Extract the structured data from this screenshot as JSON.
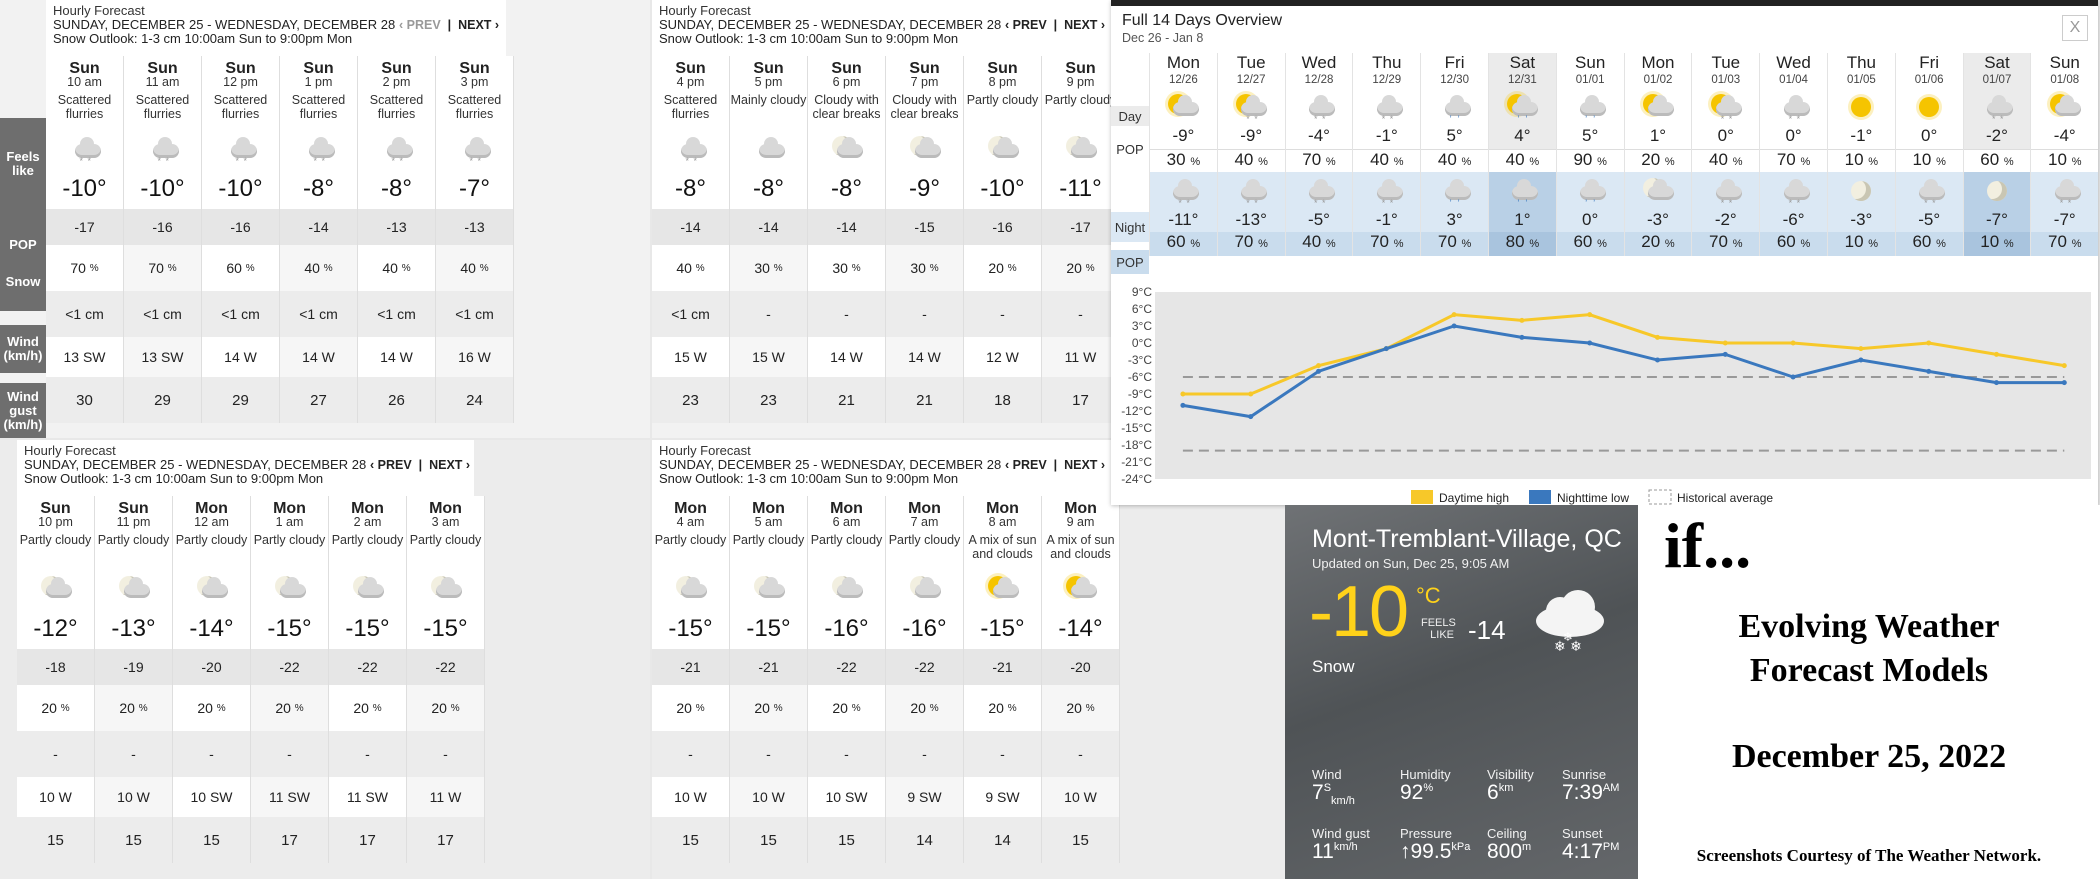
{
  "hourly_common": {
    "title": "Hourly Forecast",
    "dates": "SUNDAY, DECEMBER 25 - WEDNESDAY, DECEMBER 28",
    "outlook": "Snow Outlook: 1-3 cm 10:00am Sun to 9:00pm Mon",
    "prev": "‹ PREV",
    "next": "NEXT ›"
  },
  "row_labels": {
    "feels_like": "Feels like",
    "pop": "POP",
    "snow": "Snow",
    "wind": "Wind (km/h)",
    "wind_gust": "Wind gust (km/h)"
  },
  "panels": [
    {
      "hours": [
        {
          "day": "Sun",
          "hour": "10 am",
          "cond": "Scattered flurries",
          "temp": "-10°",
          "feels": "-17",
          "pop": "70",
          "snow": "<1 cm",
          "wind": "13 SW",
          "gust": "30",
          "icon": "cloud-snow-icon"
        },
        {
          "day": "Sun",
          "hour": "11 am",
          "cond": "Scattered flurries",
          "temp": "-10°",
          "feels": "-16",
          "pop": "70",
          "snow": "<1 cm",
          "wind": "13 SW",
          "gust": "29",
          "icon": "cloud-snow-icon"
        },
        {
          "day": "Sun",
          "hour": "12 pm",
          "cond": "Scattered flurries",
          "temp": "-10°",
          "feels": "-16",
          "pop": "60",
          "snow": "<1 cm",
          "wind": "14 W",
          "gust": "29",
          "icon": "cloud-snow-icon"
        },
        {
          "day": "Sun",
          "hour": "1 pm",
          "cond": "Scattered flurries",
          "temp": "-8°",
          "feels": "-14",
          "pop": "40",
          "snow": "<1 cm",
          "wind": "14 W",
          "gust": "27",
          "icon": "cloud-snow-icon"
        },
        {
          "day": "Sun",
          "hour": "2 pm",
          "cond": "Scattered flurries",
          "temp": "-8°",
          "feels": "-13",
          "pop": "40",
          "snow": "<1 cm",
          "wind": "14 W",
          "gust": "26",
          "icon": "cloud-snow-icon"
        },
        {
          "day": "Sun",
          "hour": "3 pm",
          "cond": "Scattered flurries",
          "temp": "-7°",
          "feels": "-13",
          "pop": "40",
          "snow": "<1 cm",
          "wind": "16 W",
          "gust": "24",
          "icon": "cloud-snow-icon"
        }
      ]
    },
    {
      "hours": [
        {
          "day": "Sun",
          "hour": "4 pm",
          "cond": "Scattered flurries",
          "temp": "-8°",
          "feels": "-14",
          "pop": "40",
          "snow": "<1 cm",
          "wind": "15 W",
          "gust": "23",
          "icon": "cloud-snow-icon"
        },
        {
          "day": "Sun",
          "hour": "5 pm",
          "cond": "Mainly cloudy",
          "temp": "-8°",
          "feels": "-14",
          "pop": "30",
          "snow": "-",
          "wind": "15 W",
          "gust": "23",
          "icon": "cloud-icon"
        },
        {
          "day": "Sun",
          "hour": "6 pm",
          "cond": "Cloudy with clear breaks",
          "temp": "-8°",
          "feels": "-14",
          "pop": "30",
          "snow": "-",
          "wind": "14 W",
          "gust": "21",
          "icon": "moon-cloud-icon"
        },
        {
          "day": "Sun",
          "hour": "7 pm",
          "cond": "Cloudy with clear breaks",
          "temp": "-9°",
          "feels": "-15",
          "pop": "30",
          "snow": "-",
          "wind": "14 W",
          "gust": "21",
          "icon": "moon-cloud-icon"
        },
        {
          "day": "Sun",
          "hour": "8 pm",
          "cond": "Partly cloudy",
          "temp": "-10°",
          "feels": "-16",
          "pop": "20",
          "snow": "-",
          "wind": "12 W",
          "gust": "18",
          "icon": "moon-cloud-icon"
        },
        {
          "day": "Sun",
          "hour": "9 pm",
          "cond": "Partly cloudy",
          "temp": "-11°",
          "feels": "-17",
          "pop": "20",
          "snow": "-",
          "wind": "11 W",
          "gust": "17",
          "icon": "moon-cloud-icon"
        }
      ]
    },
    {
      "hours": [
        {
          "day": "Sun",
          "hour": "10 pm",
          "cond": "Partly cloudy",
          "temp": "-12°",
          "feels": "-18",
          "pop": "20",
          "snow": "-",
          "wind": "10 W",
          "gust": "15",
          "icon": "moon-cloud-icon"
        },
        {
          "day": "Sun",
          "hour": "11 pm",
          "cond": "Partly cloudy",
          "temp": "-13°",
          "feels": "-19",
          "pop": "20",
          "snow": "-",
          "wind": "10 W",
          "gust": "15",
          "icon": "moon-cloud-icon"
        },
        {
          "day": "Mon",
          "hour": "12 am",
          "cond": "Partly cloudy",
          "temp": "-14°",
          "feels": "-20",
          "pop": "20",
          "snow": "-",
          "wind": "10 SW",
          "gust": "15",
          "icon": "moon-cloud-icon"
        },
        {
          "day": "Mon",
          "hour": "1 am",
          "cond": "Partly cloudy",
          "temp": "-15°",
          "feels": "-22",
          "pop": "20",
          "snow": "-",
          "wind": "11 SW",
          "gust": "17",
          "icon": "moon-cloud-icon"
        },
        {
          "day": "Mon",
          "hour": "2 am",
          "cond": "Partly cloudy",
          "temp": "-15°",
          "feels": "-22",
          "pop": "20",
          "snow": "-",
          "wind": "11 SW",
          "gust": "17",
          "icon": "moon-cloud-icon"
        },
        {
          "day": "Mon",
          "hour": "3 am",
          "cond": "Partly cloudy",
          "temp": "-15°",
          "feels": "-22",
          "pop": "20",
          "snow": "-",
          "wind": "11 W",
          "gust": "17",
          "icon": "moon-cloud-icon"
        }
      ]
    },
    {
      "hours": [
        {
          "day": "Mon",
          "hour": "4 am",
          "cond": "Partly cloudy",
          "temp": "-15°",
          "feels": "-21",
          "pop": "20",
          "snow": "-",
          "wind": "10 W",
          "gust": "15",
          "icon": "moon-cloud-icon"
        },
        {
          "day": "Mon",
          "hour": "5 am",
          "cond": "Partly cloudy",
          "temp": "-15°",
          "feels": "-21",
          "pop": "20",
          "snow": "-",
          "wind": "10 W",
          "gust": "15",
          "icon": "moon-cloud-icon"
        },
        {
          "day": "Mon",
          "hour": "6 am",
          "cond": "Partly cloudy",
          "temp": "-16°",
          "feels": "-22",
          "pop": "20",
          "snow": "-",
          "wind": "10 SW",
          "gust": "15",
          "icon": "moon-cloud-icon"
        },
        {
          "day": "Mon",
          "hour": "7 am",
          "cond": "Partly cloudy",
          "temp": "-16°",
          "feels": "-22",
          "pop": "20",
          "snow": "-",
          "wind": "9 SW",
          "gust": "14",
          "icon": "moon-cloud-icon"
        },
        {
          "day": "Mon",
          "hour": "8 am",
          "cond": "A mix of sun and clouds",
          "temp": "-15°",
          "feels": "-21",
          "pop": "20",
          "snow": "-",
          "wind": "9 SW",
          "gust": "14",
          "icon": "sun-cloud-icon"
        },
        {
          "day": "Mon",
          "hour": "9 am",
          "cond": "A mix of sun and clouds",
          "temp": "-14°",
          "feels": "-20",
          "pop": "20",
          "snow": "-",
          "wind": "10 W",
          "gust": "15",
          "icon": "sun-cloud-icon"
        }
      ]
    }
  ],
  "overview": {
    "title": "Full 14 Days Overview",
    "range": "Dec 26 - Jan 8",
    "close": "X",
    "row_labels": {
      "day": "Day",
      "pop": "POP",
      "night": "Night",
      "npop": "POP"
    },
    "days": [
      {
        "dow": "Mon",
        "date": "12/26",
        "hi": "-9°",
        "pop": "30",
        "lo": "-11°",
        "npop": "60",
        "dicon": "sun-cloud-icon",
        "nicon": "cloud-snow-icon"
      },
      {
        "dow": "Tue",
        "date": "12/27",
        "hi": "-9°",
        "pop": "40",
        "lo": "-13°",
        "npop": "70",
        "dicon": "sun-cloud-snow-icon",
        "nicon": "cloud-snow-icon"
      },
      {
        "dow": "Wed",
        "date": "12/28",
        "hi": "-4°",
        "pop": "70",
        "lo": "-5°",
        "npop": "40",
        "dicon": "cloud-snow-icon",
        "nicon": "cloud-snow-icon"
      },
      {
        "dow": "Thu",
        "date": "12/29",
        "hi": "-1°",
        "pop": "40",
        "lo": "-1°",
        "npop": "70",
        "dicon": "cloud-snow-icon",
        "nicon": "cloud-snow-icon"
      },
      {
        "dow": "Fri",
        "date": "12/30",
        "hi": "5°",
        "pop": "40",
        "lo": "3°",
        "npop": "70",
        "dicon": "cloud-rain-icon",
        "nicon": "cloud-rain-icon"
      },
      {
        "dow": "Sat",
        "date": "12/31",
        "hi": "4°",
        "pop": "40",
        "lo": "1°",
        "npop": "80",
        "dicon": "sun-cloud-rain-icon",
        "nicon": "cloud-rain-icon",
        "hl": true
      },
      {
        "dow": "Sun",
        "date": "01/01",
        "hi": "5°",
        "pop": "90",
        "lo": "0°",
        "npop": "60",
        "dicon": "cloud-rain-icon",
        "nicon": "cloud-rain-icon"
      },
      {
        "dow": "Mon",
        "date": "01/02",
        "hi": "1°",
        "pop": "20",
        "lo": "-3°",
        "npop": "20",
        "dicon": "sun-cloud-icon",
        "nicon": "moon-cloud-icon"
      },
      {
        "dow": "Tue",
        "date": "01/03",
        "hi": "0°",
        "pop": "40",
        "lo": "-2°",
        "npop": "70",
        "dicon": "sun-cloud-snow-icon",
        "nicon": "cloud-snow-icon"
      },
      {
        "dow": "Wed",
        "date": "01/04",
        "hi": "0°",
        "pop": "70",
        "lo": "-6°",
        "npop": "60",
        "dicon": "cloud-snow-icon",
        "nicon": "cloud-snow-icon"
      },
      {
        "dow": "Thu",
        "date": "01/05",
        "hi": "-1°",
        "pop": "10",
        "lo": "-3°",
        "npop": "10",
        "dicon": "sun-icon",
        "nicon": "moon-icon"
      },
      {
        "dow": "Fri",
        "date": "01/06",
        "hi": "0°",
        "pop": "10",
        "lo": "-5°",
        "npop": "60",
        "dicon": "sun-icon",
        "nicon": "cloud-snow-icon"
      },
      {
        "dow": "Sat",
        "date": "01/07",
        "hi": "-2°",
        "pop": "60",
        "lo": "-7°",
        "npop": "10",
        "dicon": "cloud-snow-icon",
        "nicon": "moon-icon",
        "hl": true
      },
      {
        "dow": "Sun",
        "date": "01/08",
        "hi": "-4°",
        "pop": "10",
        "lo": "-7°",
        "npop": "70",
        "dicon": "sun-cloud-icon",
        "nicon": "cloud-snow-icon"
      }
    ]
  },
  "chart_data": {
    "type": "line",
    "x": [
      "12/26",
      "12/27",
      "12/28",
      "12/29",
      "12/30",
      "12/31",
      "01/01",
      "01/02",
      "01/03",
      "01/04",
      "01/05",
      "01/06",
      "01/07",
      "01/08"
    ],
    "series": [
      {
        "name": "Daytime high",
        "color": "#f7c829",
        "values": [
          -9,
          -9,
          -4,
          -1,
          5,
          4,
          5,
          1,
          0,
          0,
          -1,
          0,
          -2,
          -4
        ]
      },
      {
        "name": "Nighttime low",
        "color": "#3a78be",
        "values": [
          -11,
          -13,
          -5,
          -1,
          3,
          1,
          0,
          -3,
          -2,
          -6,
          -3,
          -5,
          -7,
          -7
        ]
      },
      {
        "name": "Historical average",
        "color": "#999999",
        "values_upper": [
          -6,
          -6,
          -6,
          -6,
          -6,
          -6,
          -6,
          -6,
          -6,
          -6,
          -6,
          -6,
          -6,
          -6
        ],
        "values_lower": [
          -19,
          -19,
          -19,
          -19,
          -19,
          -19,
          -19,
          -19,
          -19,
          -19,
          -19,
          -19,
          -19,
          -19
        ]
      }
    ],
    "yticks": [
      "9°C",
      "6°C",
      "3°C",
      "0°C",
      "-3°C",
      "-6°C",
      "-9°C",
      "-12°C",
      "-15°C",
      "-18°C",
      "-21°C",
      "-24°C"
    ],
    "ylim": [
      -24,
      9
    ],
    "legend_position": "bottom",
    "legend": [
      "Daytime high",
      "Nighttime low",
      "Historical average"
    ]
  },
  "current": {
    "location": "Mont-Tremblant-Village, QC",
    "updated": "Updated on Sun, Dec 25, 9:05 AM",
    "temp": "-10",
    "unit": "°C",
    "feels_label_1": "FEELS",
    "feels_label_2": "LIKE",
    "feels": "-14",
    "condition": "Snow",
    "stats": {
      "wind_label": "Wind",
      "wind_val": "7",
      "wind_dir": "S",
      "wind_unit": "km/h",
      "humidity_label": "Humidity",
      "humidity_val": "92",
      "humidity_unit": "%",
      "visibility_label": "Visibility",
      "visibility_val": "6",
      "visibility_unit": "km",
      "sunrise_label": "Sunrise",
      "sunrise_val": "7:39",
      "sunrise_unit": "AM",
      "gust_label": "Wind gust",
      "gust_val": "11",
      "gust_unit": "km/h",
      "pressure_label": "Pressure",
      "pressure_val": "↑99.5",
      "pressure_unit": "kPa",
      "ceiling_label": "Ceiling",
      "ceiling_val": "800",
      "ceiling_unit": "m",
      "sunset_label": "Sunset",
      "sunset_val": "4:17",
      "sunset_unit": "PM"
    }
  },
  "title_card": {
    "if": "if...",
    "line1": "Evolving Weather",
    "line2": "Forecast Models",
    "date": "December 25, 2022",
    "credit": "Screenshots Courtesy of The Weather Network."
  }
}
